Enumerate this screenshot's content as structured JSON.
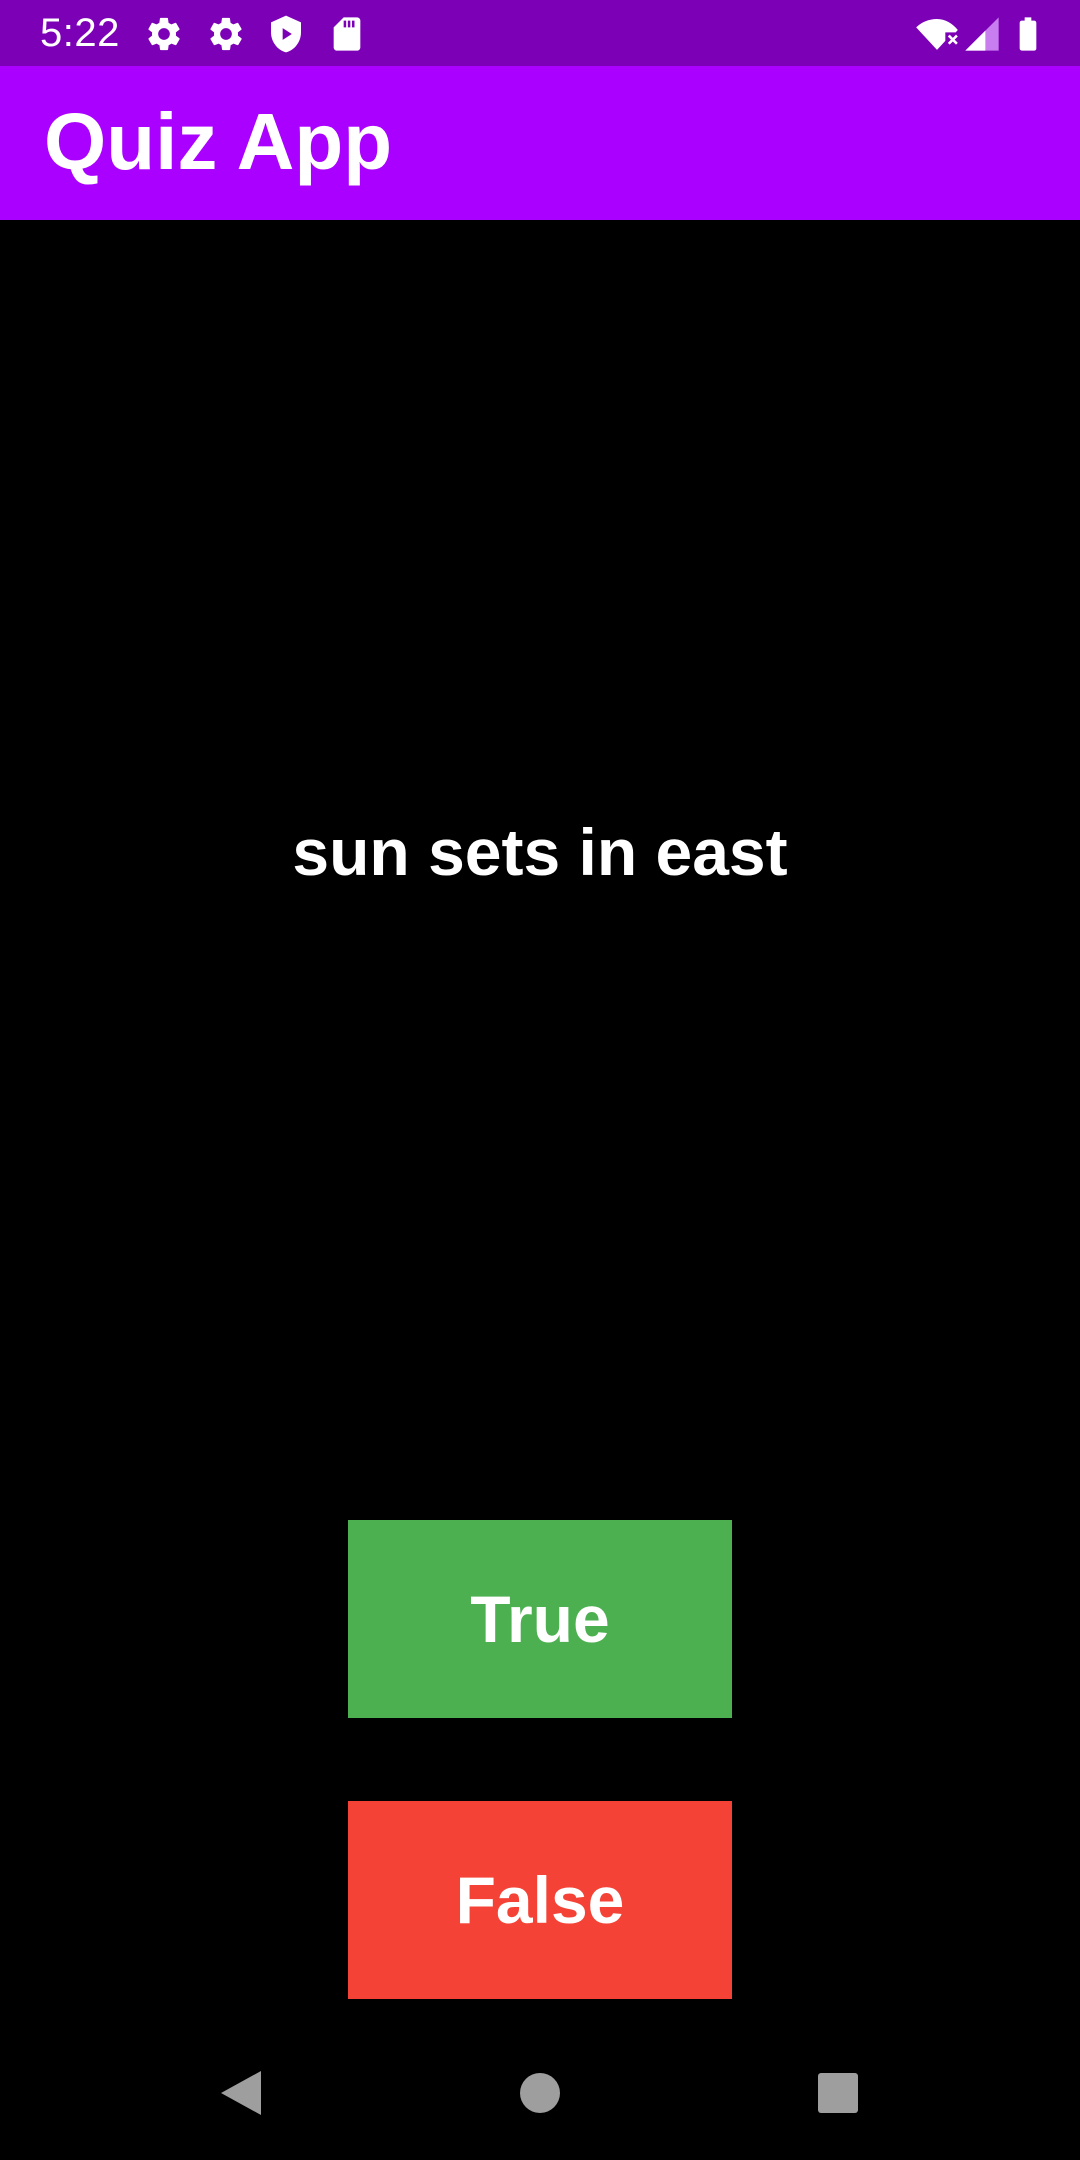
{
  "status_bar": {
    "time": "5:22",
    "icons": [
      "settings-icon",
      "settings-icon",
      "play-protect-icon",
      "sd-card-icon",
      "wifi-off-icon",
      "signal-icon",
      "battery-icon"
    ]
  },
  "app_bar": {
    "title": "Quiz App"
  },
  "question": {
    "text": "sun sets in east"
  },
  "answers": {
    "true_label": "True",
    "false_label": "False"
  },
  "nav_bar": {
    "icons": [
      "back-icon",
      "home-icon",
      "recents-icon"
    ]
  },
  "colors": {
    "status_bar": "#7b00b6",
    "app_bar": "#aa00ff",
    "background": "#000000",
    "true_button": "#4caf50",
    "false_button": "#f44336",
    "nav_icon": "#9e9e9e"
  }
}
